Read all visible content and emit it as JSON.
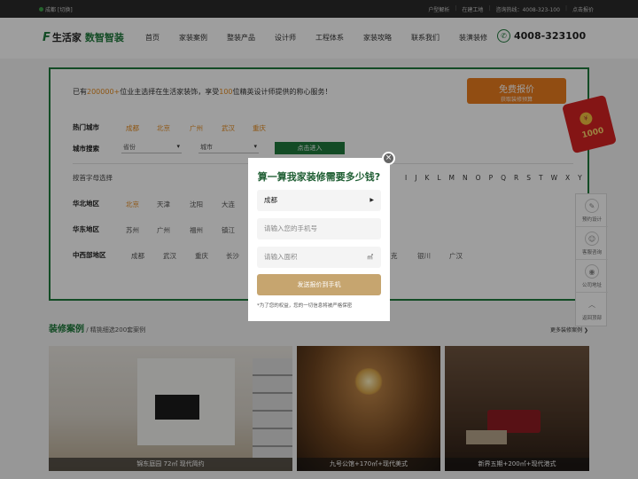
{
  "topbar": {
    "location": "成都",
    "switch": "[切换]",
    "links": [
      "户型解析",
      "在建工地",
      "咨询热线：4008-323-100",
      "点击报价"
    ]
  },
  "header": {
    "logo_main": "生活家",
    "logo_sub": "数智智装",
    "nav": [
      "首页",
      "家装案例",
      "整装产品",
      "设计师",
      "工程体系",
      "家装攻略",
      "联系我们",
      "装潢装修"
    ],
    "phone": "4008-323100"
  },
  "panel": {
    "slogan_pre": "已有",
    "slogan_count": "200000+",
    "slogan_mid": "位业主选择在生活家装饰，享受",
    "slogan_designers": "100",
    "slogan_post": "位精英设计师提供的称心服务！",
    "quote_title": "免费报价",
    "quote_sub": "获取装修预算",
    "hot_label": "热门城市",
    "hot_cities": [
      "成都",
      "北京",
      "广州",
      "武汉",
      "重庆"
    ],
    "search_label": "城市搜索",
    "province_placeholder": "省份",
    "city_placeholder": "城市",
    "enter_label": "点击进入",
    "letter_label": "按首字母选择",
    "letters": [
      "I",
      "J",
      "K",
      "L",
      "M",
      "N",
      "O",
      "P",
      "Q",
      "R",
      "S",
      "T",
      "W",
      "X",
      "Y"
    ],
    "regions": [
      {
        "label": "华北地区",
        "cities": [
          "北京",
          "天津",
          "沈阳",
          "大连"
        ]
      },
      {
        "label": "华东地区",
        "cities": [
          "苏州",
          "广州",
          "福州",
          "镇江"
        ]
      },
      {
        "label": "中西部地区",
        "cities": [
          "成都",
          "武汉",
          "重庆",
          "长沙",
          "克",
          "银川",
          "广汉"
        ]
      }
    ]
  },
  "redpacket": {
    "amount": "1000"
  },
  "sidetools": [
    "预约设计",
    "客服咨询",
    "公司地址",
    "返回顶部"
  ],
  "cases": {
    "title": "装修案例",
    "subtitle": " / 精挑细选200套案例",
    "more": "更多装修案例 ❯",
    "items": [
      {
        "caption": "锦东庭园 72㎡ 现代简约"
      },
      {
        "caption": "九号公馆+170㎡+现代美式"
      },
      {
        "caption": "新界五期+200㎡+现代港式"
      }
    ]
  },
  "modal": {
    "title": "算一算我家装修需要多少钱?",
    "city_value": "成都",
    "phone_placeholder": "请输入您的手机号",
    "area_placeholder": "请输入面积",
    "area_unit": "㎡",
    "submit_label": "发送报价到手机",
    "note": "*为了您的权益，您的一切信息将被严格保密",
    "close": "×"
  }
}
